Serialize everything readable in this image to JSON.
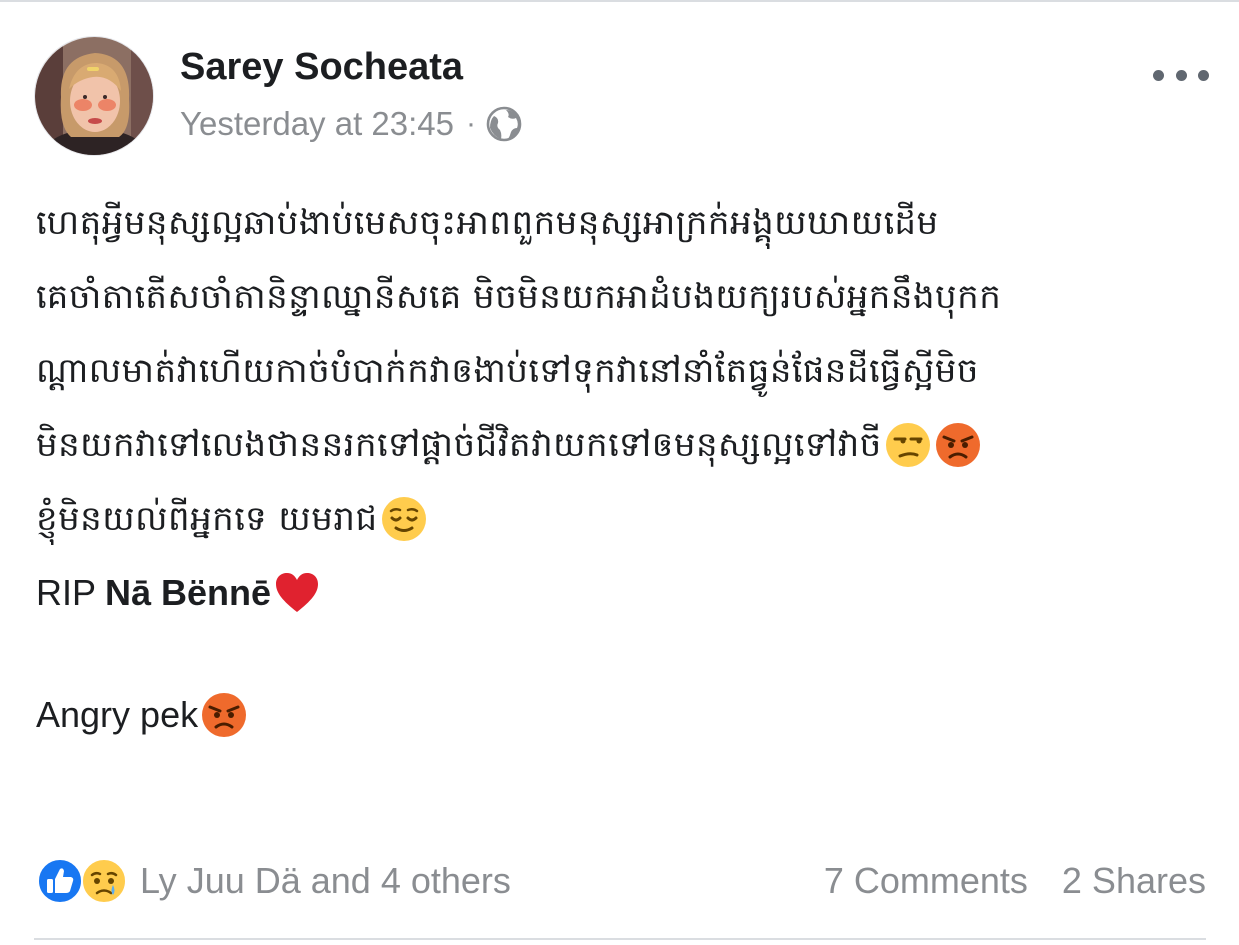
{
  "post": {
    "author": "Sarey Socheata",
    "timestamp": "Yesterday at 23:45",
    "separator": "·",
    "privacy_icon": "globe-icon",
    "more_icon": "more-dots-icon",
    "lines": [
      {
        "text": "ហេតុអ្វីមនុស្សល្អឆាប់ងាប់មេសចុះអាពពួកមនុស្សអាក្រក់អង្គុយឃាយដេីម",
        "emojis": []
      },
      {
        "text": "គេចាំតាតេីសចាំតានិន្ទាឈ្នានីសគេ មិចមិនយកអាដំបងយក្យរបស់អ្នកនឹងបុកក",
        "emojis": []
      },
      {
        "text": "ណ្ដាលមាត់វាហេីយកាច់បំបាក់កវាឲងាប់ទៅទុកវានៅនាំតែធ្វូន់ផែនដីធ្វេីស្អីមិច",
        "emojis": []
      },
      {
        "text": "មិនយកវាទៅលេងថាននរកទៅផ្ដាច់ជីវិតវាយកទៅឲមនុស្សល្អទៅវាចី",
        "emojis": [
          "unamused-emoji",
          "angry-emoji"
        ]
      },
      {
        "text": "ខ្ញុំមិនយល់ពីអ្នកទេ យមរាជ",
        "emojis": [
          "relieved-emoji"
        ]
      }
    ],
    "rip_prefix": "RIP ",
    "rip_name": "Nā Bënnē",
    "rip_emoji": "red-heart-emoji",
    "closing_text": "Angry pek",
    "closing_emoji": "angry-emoji"
  },
  "footer": {
    "reaction_icons": [
      "like-icon",
      "sad-icon"
    ],
    "reactors": "Ly Juu Dä and 4 others",
    "comments": "7 Comments",
    "shares": "2 Shares"
  },
  "colors": {
    "text": "#1c1e21",
    "meta": "#8a8d91",
    "like_blue": "#1877f2",
    "emoji_yellow": "#ffcc4d",
    "angry_red": "#e8541c",
    "heart_red": "#e0222f",
    "divider": "#dadde1"
  }
}
